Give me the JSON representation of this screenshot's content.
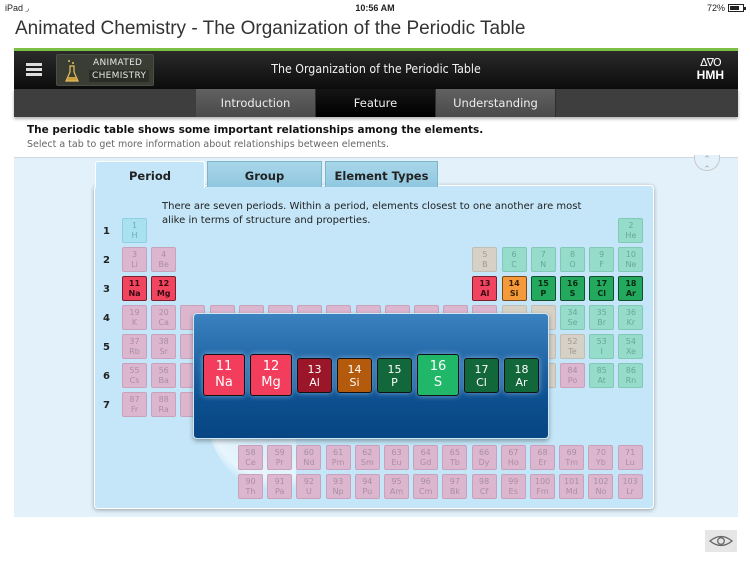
{
  "status_bar": {
    "device": "iPad",
    "wifi_icon": "wifi-icon",
    "time": "10:56 AM",
    "battery": "72%",
    "battery_level": 0.72
  },
  "app_title": "Animated Chemistry - The Organization of the Periodic Table",
  "header": {
    "menu_icon": "hamburger-icon",
    "brand_line1": "ANIMATED",
    "brand_line2": "CHEMISTRY",
    "title": "The Organization of the Periodic Table",
    "publisher_symbols": "Δ∇O",
    "publisher": "HMH"
  },
  "nav_tabs": [
    {
      "label": "Introduction",
      "active": false
    },
    {
      "label": "Feature",
      "active": true
    },
    {
      "label": "Understanding",
      "active": false
    }
  ],
  "intro": {
    "heading": "The periodic table shows some important relationships among the elements.",
    "subtext": "Select a tab to get more information about relationships between elements."
  },
  "sub_tabs": [
    {
      "label": "Period",
      "active": true
    },
    {
      "label": "Group",
      "active": false
    },
    {
      "label": "Element Types",
      "active": false
    }
  ],
  "description": "There are seven periods. Within a period, elements closest to one another are most alike in terms of structure and properties.",
  "period_labels": [
    "1",
    "2",
    "3",
    "4",
    "5",
    "6",
    "7"
  ],
  "elements": [
    {
      "n": "1",
      "s": "H",
      "row": 1,
      "col": 1,
      "type": "h"
    },
    {
      "n": "2",
      "s": "He",
      "row": 1,
      "col": 18,
      "type": "non"
    },
    {
      "n": "3",
      "s": "Li",
      "row": 2,
      "col": 1,
      "type": "alk"
    },
    {
      "n": "4",
      "s": "Be",
      "row": 2,
      "col": 2,
      "type": "alk"
    },
    {
      "n": "5",
      "s": "B",
      "row": 2,
      "col": 13,
      "type": "semi"
    },
    {
      "n": "6",
      "s": "C",
      "row": 2,
      "col": 14,
      "type": "non"
    },
    {
      "n": "7",
      "s": "N",
      "row": 2,
      "col": 15,
      "type": "non"
    },
    {
      "n": "8",
      "s": "O",
      "row": 2,
      "col": 16,
      "type": "non"
    },
    {
      "n": "9",
      "s": "F",
      "row": 2,
      "col": 17,
      "type": "non"
    },
    {
      "n": "10",
      "s": "Ne",
      "row": 2,
      "col": 18,
      "type": "non"
    },
    {
      "n": "11",
      "s": "Na",
      "row": 3,
      "col": 1,
      "type": "hi-red"
    },
    {
      "n": "12",
      "s": "Mg",
      "row": 3,
      "col": 2,
      "type": "hi-red"
    },
    {
      "n": "13",
      "s": "Al",
      "row": 3,
      "col": 13,
      "type": "hi-red"
    },
    {
      "n": "14",
      "s": "Si",
      "row": 3,
      "col": 14,
      "type": "hi-orange"
    },
    {
      "n": "15",
      "s": "P",
      "row": 3,
      "col": 15,
      "type": "hi-green"
    },
    {
      "n": "16",
      "s": "S",
      "row": 3,
      "col": 16,
      "type": "hi-green"
    },
    {
      "n": "17",
      "s": "Cl",
      "row": 3,
      "col": 17,
      "type": "hi-green"
    },
    {
      "n": "18",
      "s": "Ar",
      "row": 3,
      "col": 18,
      "type": "hi-green"
    },
    {
      "n": "19",
      "s": "K",
      "row": 4,
      "col": 1,
      "type": "alk"
    },
    {
      "n": "20",
      "s": "Ca",
      "row": 4,
      "col": 2,
      "type": "alk"
    },
    {
      "n": "34",
      "s": "Se",
      "row": 4,
      "col": 16,
      "type": "non"
    },
    {
      "n": "35",
      "s": "Br",
      "row": 4,
      "col": 17,
      "type": "non"
    },
    {
      "n": "36",
      "s": "Kr",
      "row": 4,
      "col": 18,
      "type": "non"
    },
    {
      "n": "37",
      "s": "Rb",
      "row": 5,
      "col": 1,
      "type": "alk"
    },
    {
      "n": "38",
      "s": "Sr",
      "row": 5,
      "col": 2,
      "type": "alk"
    },
    {
      "n": "52",
      "s": "Te",
      "row": 5,
      "col": 16,
      "type": "semi"
    },
    {
      "n": "53",
      "s": "I",
      "row": 5,
      "col": 17,
      "type": "non"
    },
    {
      "n": "54",
      "s": "Xe",
      "row": 5,
      "col": 18,
      "type": "non"
    },
    {
      "n": "55",
      "s": "Cs",
      "row": 6,
      "col": 1,
      "type": "alk"
    },
    {
      "n": "56",
      "s": "Ba",
      "row": 6,
      "col": 2,
      "type": "alk"
    },
    {
      "n": "84",
      "s": "Po",
      "row": 6,
      "col": 16,
      "type": "met"
    },
    {
      "n": "85",
      "s": "At",
      "row": 6,
      "col": 17,
      "type": "non"
    },
    {
      "n": "86",
      "s": "Rn",
      "row": 6,
      "col": 18,
      "type": "non"
    },
    {
      "n": "87",
      "s": "Fr",
      "row": 7,
      "col": 1,
      "type": "alk"
    },
    {
      "n": "88",
      "s": "Ra",
      "row": 7,
      "col": 2,
      "type": "alk"
    }
  ],
  "lanthanides": [
    {
      "n": "58",
      "s": "Ce"
    },
    {
      "n": "59",
      "s": "Pr"
    },
    {
      "n": "60",
      "s": "Nd"
    },
    {
      "n": "61",
      "s": "Pm"
    },
    {
      "n": "62",
      "s": "Sm"
    },
    {
      "n": "63",
      "s": "Eu"
    },
    {
      "n": "64",
      "s": "Gd"
    },
    {
      "n": "65",
      "s": "Tb"
    },
    {
      "n": "66",
      "s": "Dy"
    },
    {
      "n": "67",
      "s": "Ho"
    },
    {
      "n": "68",
      "s": "Er"
    },
    {
      "n": "69",
      "s": "Tm"
    },
    {
      "n": "70",
      "s": "Yb"
    },
    {
      "n": "71",
      "s": "Lu"
    }
  ],
  "actinides": [
    {
      "n": "90",
      "s": "Th"
    },
    {
      "n": "91",
      "s": "Pa"
    },
    {
      "n": "92",
      "s": "U"
    },
    {
      "n": "93",
      "s": "Np"
    },
    {
      "n": "94",
      "s": "Pu"
    },
    {
      "n": "95",
      "s": "Am"
    },
    {
      "n": "96",
      "s": "Cm"
    },
    {
      "n": "97",
      "s": "Bk"
    },
    {
      "n": "98",
      "s": "Cf"
    },
    {
      "n": "99",
      "s": "Es"
    },
    {
      "n": "100",
      "s": "Fm"
    },
    {
      "n": "101",
      "s": "Md"
    },
    {
      "n": "102",
      "s": "No"
    },
    {
      "n": "103",
      "s": "Lr"
    }
  ],
  "period3_zoom": [
    {
      "n": "11",
      "s": "Na",
      "color": "#f23e5c",
      "enlarged": true
    },
    {
      "n": "12",
      "s": "Mg",
      "color": "#f23e5c",
      "enlarged": true
    },
    {
      "n": "13",
      "s": "Al",
      "color": "#9a1628",
      "enlarged": false
    },
    {
      "n": "14",
      "s": "Si",
      "color": "#b45a0c",
      "enlarged": false
    },
    {
      "n": "15",
      "s": "P",
      "color": "#12683a",
      "enlarged": false
    },
    {
      "n": "16",
      "s": "S",
      "color": "#20b868",
      "enlarged": true
    },
    {
      "n": "17",
      "s": "Cl",
      "color": "#12683a",
      "enlarged": false
    },
    {
      "n": "18",
      "s": "Ar",
      "color": "#12683a",
      "enlarged": false
    }
  ],
  "icons": {
    "collapse": "chevron-double-up-icon",
    "view": "eye-icon"
  }
}
